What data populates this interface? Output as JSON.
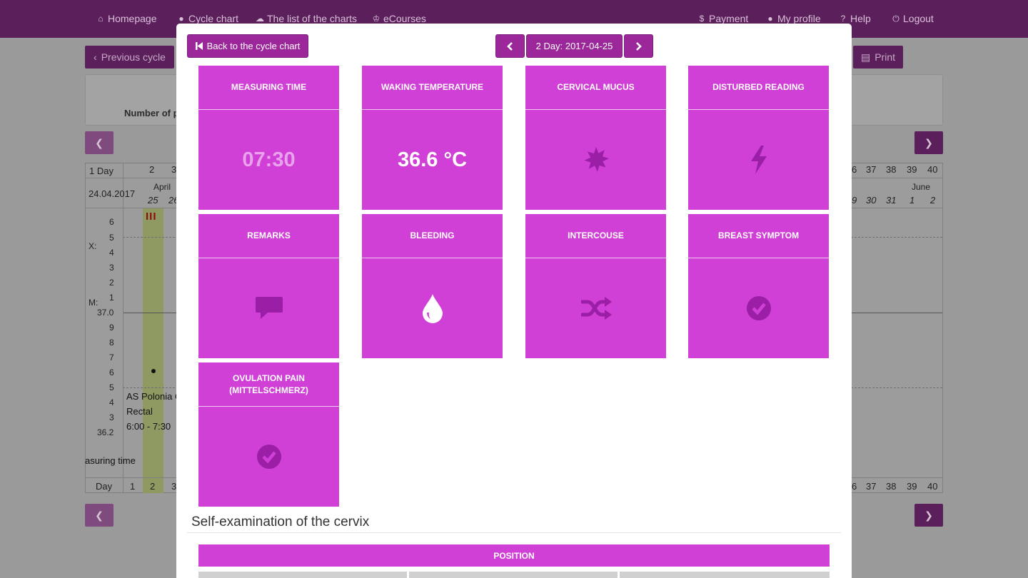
{
  "nav": {
    "homepage": "Homepage",
    "cycle_chart": "Cycle chart",
    "list_of_charts": "The list of the charts",
    "ecourses": "eCourses",
    "payment": "Payment",
    "my_profile": "My profile",
    "help": "Help",
    "logout": "Logout"
  },
  "background": {
    "previous_cycle": "Previous cycle",
    "print": "Print",
    "number_label": "Number of p",
    "day_header": "1 Day",
    "date": "24.04.2017",
    "days_top": [
      "2",
      "3"
    ],
    "days_right": [
      "6",
      "37",
      "38",
      "39",
      "40"
    ],
    "month_left": "April",
    "month_right": "June",
    "dates_left": [
      "25",
      "26"
    ],
    "dates_right": [
      "9",
      "30",
      "31",
      "1",
      "2"
    ],
    "x_label": "X:",
    "m_label": "M:",
    "y_upper": [
      "6",
      "5",
      "4",
      "3",
      "2",
      "1"
    ],
    "y_mid": "37.0",
    "y_lower": [
      "9",
      "8",
      "7",
      "6",
      "5",
      "4",
      "3"
    ],
    "y_bottom": "36.2",
    "info_lines": [
      "AS Polonia C",
      "Rectal",
      "6:00 - 7:30"
    ],
    "measuring_time_label": "asuring time",
    "day_footer": "Day",
    "days_bottom_left": [
      "1",
      "2",
      "3"
    ],
    "days_bottom_right": [
      "6",
      "37",
      "38",
      "39",
      "40"
    ]
  },
  "modal": {
    "back_button": "Back to the cycle chart",
    "day_label": "2 Day: 2017-04-25",
    "tiles": [
      {
        "title": "Measuring time",
        "value": "07:30",
        "icon": "none"
      },
      {
        "title": "Waking temperature",
        "value": "36.6 °C",
        "icon": "none"
      },
      {
        "title": "Cervical mucus",
        "value": "",
        "icon": "starburst-icon"
      },
      {
        "title": "Disturbed reading",
        "value": "",
        "icon": "lightning-icon"
      },
      {
        "title": "Remarks",
        "value": "",
        "icon": "comment-icon"
      },
      {
        "title": "Bleeding",
        "value": "",
        "icon": "droplet-icon"
      },
      {
        "title": "Intercouse",
        "value": "",
        "icon": "shuffle-icon"
      },
      {
        "title": "Breast symptom",
        "value": "",
        "icon": "check-circle-icon"
      },
      {
        "title": "Ovulation pain (Mittelschmerz)",
        "value": "",
        "icon": "check-circle-icon"
      }
    ],
    "section_title": "Self-examination of the cervix",
    "position_label": "Position"
  },
  "colors": {
    "tile": "#d03fd6",
    "button": "#9b279b",
    "nav": "#5b1f5b"
  }
}
